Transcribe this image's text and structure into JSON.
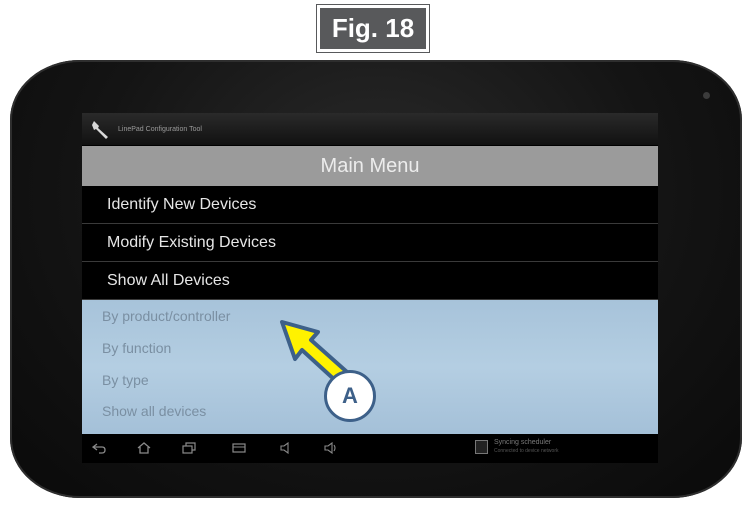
{
  "figure": {
    "label": "Fig. 18"
  },
  "app": {
    "title": "LinePad Configuration Tool"
  },
  "main_menu": {
    "title": "Main Menu",
    "items": [
      {
        "label": "Identify New Devices"
      },
      {
        "label": "Modify Existing Devices"
      },
      {
        "label": "Show All Devices"
      }
    ]
  },
  "submenu": {
    "items": [
      {
        "label": "By product/controller"
      },
      {
        "label": "By function"
      },
      {
        "label": "By type"
      },
      {
        "label": "Show all devices"
      }
    ]
  },
  "status": {
    "notification": "Syncing scheduler",
    "notification_sub": "Connected to device network"
  },
  "callout": {
    "label": "A"
  },
  "colors": {
    "callout_blue": "#3d6089",
    "arrow_yellow": "#fff200",
    "menu_header": "#9b9b9b",
    "submenu_blue": "#b4cee2"
  },
  "icons": [
    "wrench-icon",
    "back-icon",
    "home-icon",
    "recent-apps-icon",
    "screenshot-icon",
    "volume-down-icon",
    "volume-up-icon",
    "notification-icon"
  ]
}
